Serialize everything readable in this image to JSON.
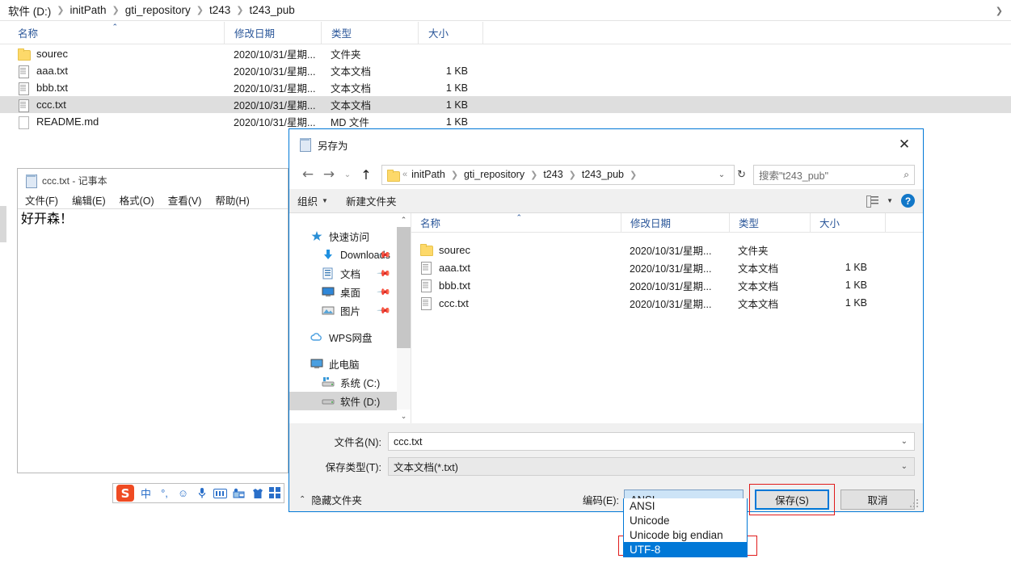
{
  "explorer": {
    "breadcrumb": [
      "软件 (D:)",
      "initPath",
      "gti_repository",
      "t243",
      "t243_pub"
    ],
    "columns": [
      "名称",
      "修改日期",
      "类型",
      "大小"
    ],
    "rows": [
      {
        "name": "sourec",
        "icon": "folder-icon",
        "date": "2020/10/31/星期...",
        "type": "文件夹",
        "size": ""
      },
      {
        "name": "aaa.txt",
        "icon": "text-file-icon",
        "date": "2020/10/31/星期...",
        "type": "文本文档",
        "size": "1 KB"
      },
      {
        "name": "bbb.txt",
        "icon": "text-file-icon",
        "date": "2020/10/31/星期...",
        "type": "文本文档",
        "size": "1 KB"
      },
      {
        "name": "ccc.txt",
        "icon": "text-file-icon",
        "date": "2020/10/31/星期...",
        "type": "文本文档",
        "size": "1 KB"
      },
      {
        "name": "README.md",
        "icon": "md-file-icon",
        "date": "2020/10/31/星期...",
        "type": "MD 文件",
        "size": "1 KB"
      }
    ]
  },
  "notepad": {
    "title": "ccc.txt - 记事本",
    "menu": [
      "文件(F)",
      "编辑(E)",
      "格式(O)",
      "查看(V)",
      "帮助(H)"
    ],
    "content": "好开森！"
  },
  "dialog": {
    "title": "另存为",
    "close_label": "✕",
    "nav": {
      "back": "←",
      "forward": "→",
      "history": "⌄",
      "up": "↑",
      "address_prefix": "«",
      "address_crumbs": [
        "initPath",
        "gti_repository",
        "t243",
        "t243_pub"
      ],
      "address_chevron": "⌄",
      "refresh": "↻",
      "search_placeholder": "搜索\"t243_pub\"",
      "search_icon": "search-icon"
    },
    "toolbar": {
      "organize": "组织",
      "new_folder": "新建文件夹",
      "view_icon": "view-list-icon",
      "view_caret": "▼",
      "help_icon": "help-icon",
      "help_glyph": "?"
    },
    "sidebar": [
      {
        "label": "快速访问",
        "icon": "quick-access-star-icon",
        "pinned": false,
        "level": 1,
        "selected": false
      },
      {
        "label": "Downloads",
        "icon": "download-arrow-icon",
        "pinned": true,
        "level": 2,
        "selected": false
      },
      {
        "label": "文档",
        "icon": "documents-icon",
        "pinned": true,
        "level": 2,
        "selected": false
      },
      {
        "label": "桌面",
        "icon": "desktop-icon",
        "pinned": true,
        "level": 2,
        "selected": false
      },
      {
        "label": "图片",
        "icon": "pictures-icon",
        "pinned": true,
        "level": 2,
        "selected": false
      },
      {
        "label": "WPS网盘",
        "icon": "cloud-icon",
        "pinned": false,
        "level": 1,
        "selected": false
      },
      {
        "label": "此电脑",
        "icon": "this-pc-icon",
        "pinned": false,
        "level": 1,
        "selected": false
      },
      {
        "label": "系统 (C:)",
        "icon": "system-drive-icon",
        "pinned": false,
        "level": 2,
        "selected": false
      },
      {
        "label": "软件 (D:)",
        "icon": "drive-icon",
        "pinned": false,
        "level": 2,
        "selected": true
      }
    ],
    "file_columns": [
      "名称",
      "修改日期",
      "类型",
      "大小"
    ],
    "files": [
      {
        "name": "sourec",
        "icon": "folder-icon",
        "date": "2020/10/31/星期...",
        "type": "文件夹",
        "size": ""
      },
      {
        "name": "aaa.txt",
        "icon": "text-file-icon",
        "date": "2020/10/31/星期...",
        "type": "文本文档",
        "size": "1 KB"
      },
      {
        "name": "bbb.txt",
        "icon": "text-file-icon",
        "date": "2020/10/31/星期...",
        "type": "文本文档",
        "size": "1 KB"
      },
      {
        "name": "ccc.txt",
        "icon": "text-file-icon",
        "date": "2020/10/31/星期...",
        "type": "文本文档",
        "size": "1 KB"
      }
    ],
    "filename_label": "文件名(N):",
    "filename_value": "ccc.txt",
    "filetype_label": "保存类型(T):",
    "filetype_value": "文本文档(*.txt)",
    "hide_folders": "隐藏文件夹",
    "hide_folders_caret": "⌃",
    "encoding_label": "编码(E):",
    "encoding_value": "ANSI",
    "encoding_chevron": "⌄",
    "encoding_options": [
      "ANSI",
      "Unicode",
      "Unicode big endian",
      "UTF-8"
    ],
    "encoding_selected": "UTF-8",
    "save_label": "保存(S)",
    "cancel_label": "取消",
    "accent_color": "#0078d7",
    "highlight_color": "#e01b1b"
  },
  "ime": {
    "logo": "S",
    "items": [
      "中",
      "°,",
      "☺",
      "mic-icon",
      "keyboard-icon",
      "toolbox-icon",
      "shirt-icon",
      "apps-icon"
    ]
  }
}
